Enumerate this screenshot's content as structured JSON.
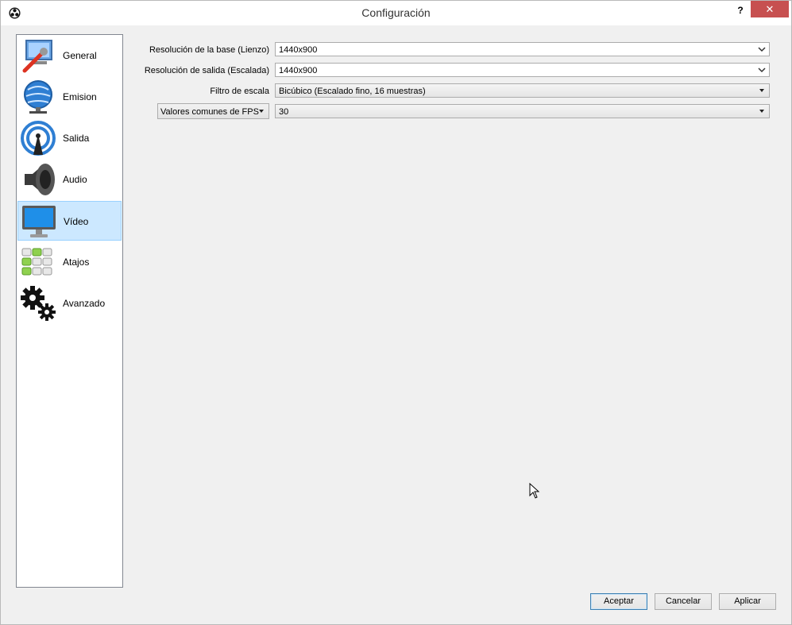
{
  "window": {
    "title": "Configuración",
    "help_label": "?",
    "close_label": "✕"
  },
  "sidebar": {
    "items": [
      {
        "label": "General",
        "icon": "general-icon",
        "selected": false
      },
      {
        "label": "Emision",
        "icon": "broadcast-icon",
        "selected": false
      },
      {
        "label": "Salida",
        "icon": "output-icon",
        "selected": false
      },
      {
        "label": "Audio",
        "icon": "speaker-icon",
        "selected": false
      },
      {
        "label": "Vídeo",
        "icon": "monitor-icon",
        "selected": true
      },
      {
        "label": "Atajos",
        "icon": "keyboard-icon",
        "selected": false
      },
      {
        "label": "Avanzado",
        "icon": "gears-icon",
        "selected": false
      }
    ]
  },
  "video": {
    "base_label": "Resolución de la base (Lienzo)",
    "base_value": "1440x900",
    "output_label": "Resolución de salida (Escalada)",
    "output_value": "1440x900",
    "filter_label": "Filtro de escala",
    "filter_value": "Bicúbico (Escalado fino, 16 muestras)",
    "fps_type_value": "Valores comunes de FPS",
    "fps_value": "30"
  },
  "buttons": {
    "accept": "Aceptar",
    "cancel": "Cancelar",
    "apply": "Aplicar"
  },
  "colors": {
    "selection": "#cce8ff",
    "close": "#c75050"
  }
}
